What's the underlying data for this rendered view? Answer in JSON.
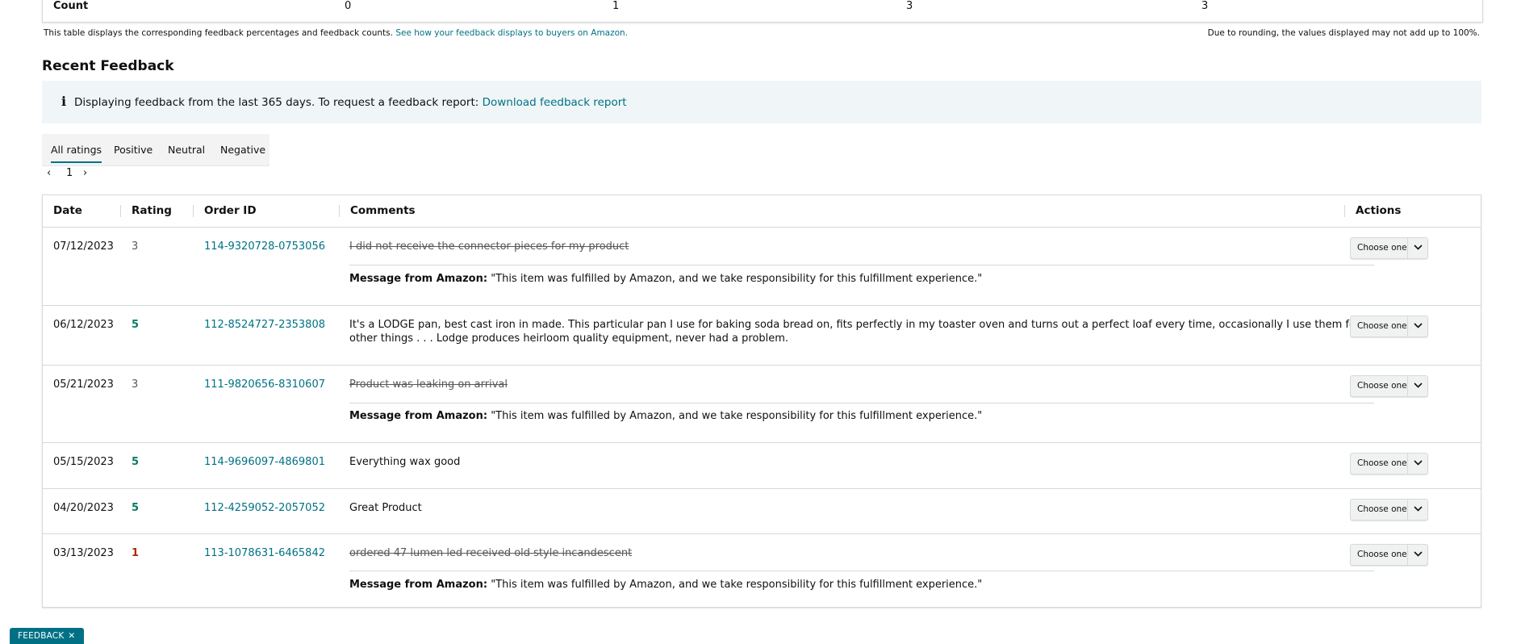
{
  "count_table": {
    "label": "Count",
    "values": [
      "0",
      "1",
      "3",
      "3"
    ]
  },
  "notes": {
    "left_text": "This table displays the corresponding feedback percentages and feedback counts.",
    "left_link": "See how your feedback displays to buyers on Amazon.",
    "right_text": "Due to rounding, the values displayed may not add up to 100%."
  },
  "recent": {
    "title": "Recent Feedback",
    "alert_icon": "i",
    "alert_text": "Displaying feedback from the last 365 days. To request a feedback report:",
    "alert_link": "Download feedback report"
  },
  "tabs": [
    "All ratings",
    "Positive",
    "Neutral",
    "Negative"
  ],
  "pager": {
    "prev": "‹",
    "page": "1",
    "next": "›"
  },
  "table": {
    "headers": {
      "date": "Date",
      "rating": "Rating",
      "order": "Order ID",
      "comments": "Comments",
      "actions": "Actions"
    },
    "message_label": "Message from Amazon:",
    "action_label": "Choose one",
    "rows": [
      {
        "date": "07/12/2023",
        "rating": "3",
        "order": "114-9320728-0753056",
        "comment": "I did not receive the connector pieces for my product",
        "message": "\"This item was fulfilled by Amazon, and we take responsibility for this fulfillment experience.\""
      },
      {
        "date": "06/12/2023",
        "rating": "5",
        "order": "112-8524727-2353808",
        "comment": "It's a LODGE pan, best cast iron in made. This particular pan I use for baking soda bread on, fits perfectly in my toaster oven and turns out a perfect loaf every time, occasionally I use them for other things . . . Lodge produces heirloom quality equipment, never had a problem."
      },
      {
        "date": "05/21/2023",
        "rating": "3",
        "order": "111-9820656-8310607",
        "comment": "Product was leaking on arrival",
        "message": "\"This item was fulfilled by Amazon, and we take responsibility for this fulfillment experience.\""
      },
      {
        "date": "05/15/2023",
        "rating": "5",
        "order": "114-9696097-4869801",
        "comment": "Everything wax good"
      },
      {
        "date": "04/20/2023",
        "rating": "5",
        "order": "112-4259052-2057052",
        "comment": "Great Product"
      },
      {
        "date": "03/13/2023",
        "rating": "1",
        "order": "113-1078631-6465842",
        "comment": "ordered 47 lumen led received old style incandescent",
        "message": "\"This item was fulfilled by Amazon, and we take responsibility for this fulfillment experience.\""
      }
    ]
  },
  "badge": {
    "label": "FEEDBACK",
    "close": "✕"
  },
  "colors": {
    "link": "#007185",
    "positive": "#067d62",
    "negative": "#b12704",
    "neutral": "#565959"
  }
}
